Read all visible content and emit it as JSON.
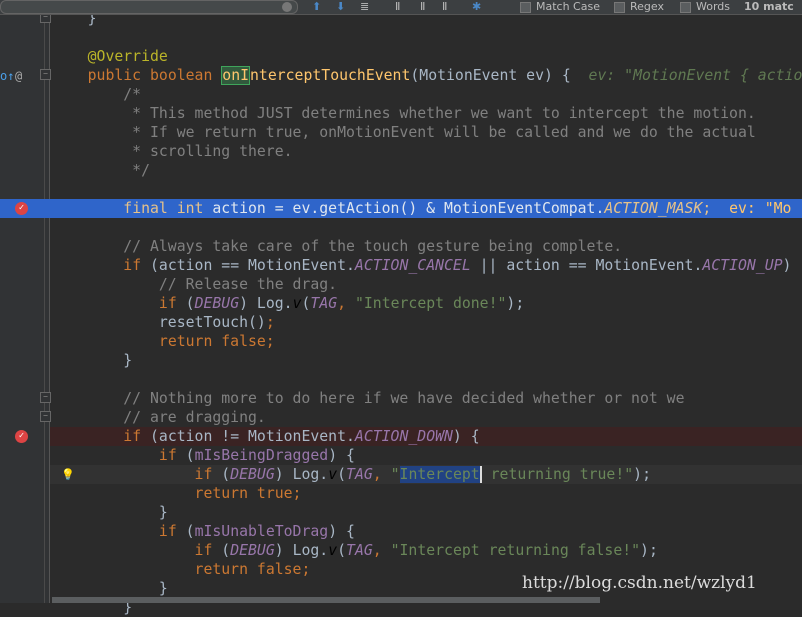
{
  "find_bar": {
    "match_case": "Match Case",
    "regex": "Regex",
    "words": "Words",
    "matches": "10 matc"
  },
  "code_lines": [
    [
      [
        "    }",
        "pl"
      ]
    ],
    [],
    [
      [
        "    @Override",
        "ann"
      ]
    ],
    [
      [
        "    ",
        "pl"
      ],
      [
        "public boolean ",
        "kw"
      ],
      [
        "onI",
        "match"
      ],
      [
        "nterceptTouchEvent",
        "decl"
      ],
      [
        "(MotionEvent ev) {  ",
        "pl"
      ],
      [
        "ev: \"MotionEvent { actio",
        "dbg"
      ]
    ],
    [
      [
        "        /*",
        "cm"
      ]
    ],
    [
      [
        "         * This method JUST determines whether we want to intercept the motion.",
        "cm"
      ]
    ],
    [
      [
        "         * If we return true, onMotionEvent will be called and we do the actual",
        "cm"
      ]
    ],
    [
      [
        "         * scrolling there.",
        "cm"
      ]
    ],
    [
      [
        "         */",
        "cm"
      ]
    ],
    [],
    [
      [
        "        ",
        "pl"
      ],
      [
        "final int ",
        "kw"
      ],
      [
        "action = ev.getAction() & MotionEventCompat.",
        "pl"
      ],
      [
        "ACTION_MASK",
        "cst"
      ],
      [
        ";  ",
        "kw"
      ],
      [
        "ev: \"Mo",
        "dbgy"
      ]
    ],
    [],
    [
      [
        "        // Always take care of the touch gesture being complete.",
        "cm"
      ]
    ],
    [
      [
        "        ",
        "pl"
      ],
      [
        "if ",
        "kw"
      ],
      [
        "(action == MotionEvent.",
        "pl"
      ],
      [
        "ACTION_CANCEL",
        "cst"
      ],
      [
        " || action == MotionEvent.",
        "pl"
      ],
      [
        "ACTION_UP",
        "cst"
      ],
      [
        ")",
        "pl"
      ]
    ],
    [
      [
        "            // Release the drag.",
        "cm"
      ]
    ],
    [
      [
        "            ",
        "pl"
      ],
      [
        "if ",
        "kw"
      ],
      [
        "(",
        "pl"
      ],
      [
        "DEBUG",
        "cst"
      ],
      [
        ") Log.",
        "pl"
      ],
      [
        "v",
        "it"
      ],
      [
        "(",
        "pl"
      ],
      [
        "TAG",
        "cst"
      ],
      [
        ", ",
        "kw"
      ],
      [
        "\"Intercept done!\"",
        "str"
      ],
      [
        ");",
        "pl"
      ]
    ],
    [
      [
        "            resetTouch()",
        "pl"
      ],
      [
        ";",
        "kw"
      ]
    ],
    [
      [
        "            ",
        "pl"
      ],
      [
        "return false;",
        "kw"
      ]
    ],
    [
      [
        "        }",
        "pl"
      ]
    ],
    [],
    [
      [
        "        // Nothing more to do here if we have decided whether or not we",
        "cm"
      ]
    ],
    [
      [
        "        // are dragging.",
        "cm"
      ]
    ],
    [
      [
        "        ",
        "pl"
      ],
      [
        "if ",
        "kw"
      ],
      [
        "(action != MotionEvent.",
        "pl"
      ],
      [
        "ACTION_DOWN",
        "cst"
      ],
      [
        ") {",
        "pl"
      ]
    ],
    [
      [
        "            ",
        "pl"
      ],
      [
        "if ",
        "kw"
      ],
      [
        "(",
        "pl"
      ],
      [
        "mIsBeingDragged",
        "fld"
      ],
      [
        ") {",
        "pl"
      ]
    ],
    [
      [
        "                ",
        "pl"
      ],
      [
        "if ",
        "kw"
      ],
      [
        "(",
        "pl"
      ],
      [
        "DEBUG",
        "cst"
      ],
      [
        ") Log.",
        "pl"
      ],
      [
        "v",
        "it"
      ],
      [
        "(",
        "pl"
      ],
      [
        "TAG",
        "cst"
      ],
      [
        ", ",
        "kw"
      ],
      [
        "\"",
        "str"
      ],
      [
        "Intercept",
        "sel"
      ],
      [
        " returning true!\"",
        "str"
      ],
      [
        ");",
        "pl"
      ]
    ],
    [
      [
        "                ",
        "pl"
      ],
      [
        "return true;",
        "kw"
      ]
    ],
    [
      [
        "            }",
        "pl"
      ]
    ],
    [
      [
        "            ",
        "pl"
      ],
      [
        "if ",
        "kw"
      ],
      [
        "(",
        "pl"
      ],
      [
        "mIsUnableToDrag",
        "fld"
      ],
      [
        ") {",
        "pl"
      ]
    ],
    [
      [
        "                ",
        "pl"
      ],
      [
        "if ",
        "kw"
      ],
      [
        "(",
        "pl"
      ],
      [
        "DEBUG",
        "cst"
      ],
      [
        ") Log.",
        "pl"
      ],
      [
        "v",
        "it"
      ],
      [
        "(",
        "pl"
      ],
      [
        "TAG",
        "cst"
      ],
      [
        ", ",
        "kw"
      ],
      [
        "\"Intercept returning false!\"",
        "str"
      ],
      [
        ");",
        "pl"
      ]
    ],
    [
      [
        "                ",
        "pl"
      ],
      [
        "return false;",
        "kw"
      ]
    ],
    [
      [
        "            }",
        "pl"
      ]
    ],
    [
      [
        "        }",
        "pl"
      ]
    ]
  ],
  "line_states": {
    "exec": [
      10
    ],
    "breakpoint": [
      22
    ],
    "current": [
      24
    ]
  },
  "gutter": {
    "breakpoints": [
      10,
      22
    ],
    "override_line": 3,
    "bulb_line": 24,
    "folds": [
      0,
      3,
      20,
      21
    ],
    "override_glyph": "o↑",
    "annotation_glyph": "@"
  },
  "watermark": "http://blog.csdn.net/wzlyd1"
}
